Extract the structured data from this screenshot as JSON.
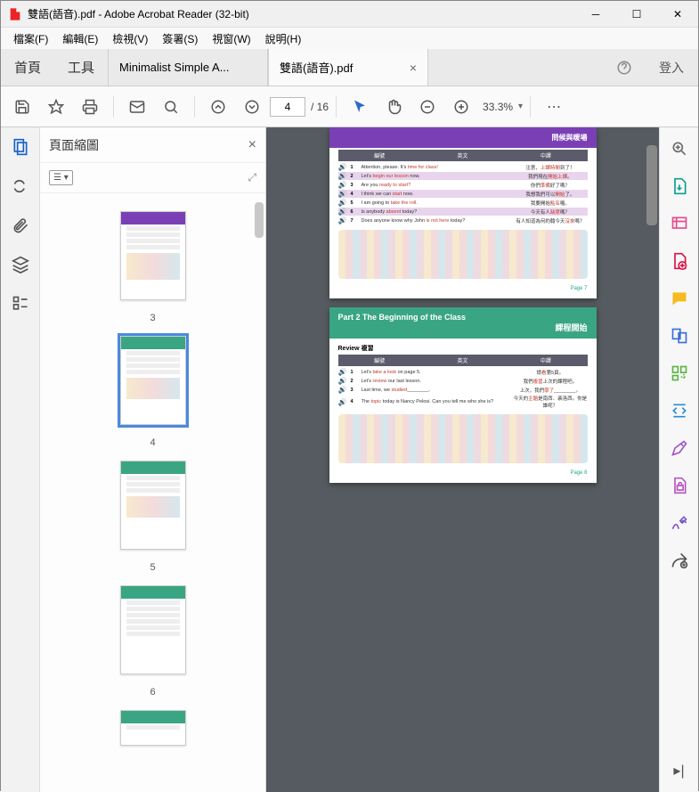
{
  "window": {
    "title": "雙語(語音).pdf - Adobe Acrobat Reader (32-bit)"
  },
  "menu": {
    "file": "檔案(F)",
    "edit": "編輯(E)",
    "view": "檢視(V)",
    "sign": "簽署(S)",
    "window": "視窗(W)",
    "help": "說明(H)"
  },
  "tabs": {
    "home": "首頁",
    "tools": "工具",
    "tab1": "Minimalist Simple A...",
    "tab2": "雙語(語音).pdf",
    "signin": "登入"
  },
  "toolbar": {
    "page_current": "4",
    "page_total": "/ 16",
    "zoom": "33.3%"
  },
  "thumbnails": {
    "title": "頁面縮圖",
    "labels": [
      "3",
      "4",
      "5",
      "6"
    ]
  },
  "doc": {
    "page4": {
      "banner": "問候與暖場",
      "head": {
        "c1": "編號",
        "c2": "英文",
        "c3": "中譯"
      },
      "rows": [
        {
          "n": "1",
          "en_a": "Attention, please. It's ",
          "en_b": "time for class!",
          "zh_a": "注意，",
          "zh_b": "上課時間",
          "zh_c": "到了！"
        },
        {
          "n": "2",
          "en_a": "Let's ",
          "en_b": "begin our lesson",
          "en_c": " now.",
          "zh_a": "我們現在",
          "zh_b": "開始上課",
          "zh_c": "。"
        },
        {
          "n": "3",
          "en_a": "Are you ",
          "en_b": "ready to start?",
          "zh_a": "你們",
          "zh_b": "準備",
          "zh_c": "好了嗎？"
        },
        {
          "n": "4",
          "en_a": "I think we can ",
          "en_b": "start",
          "en_c": " now.",
          "zh_a": "我想我們可以",
          "zh_b": "開始",
          "zh_c": "了。"
        },
        {
          "n": "5",
          "en_a": "I am going to ",
          "en_b": "take the roll.",
          "zh_a": "我要開始",
          "zh_b": "點名",
          "zh_c": "囉。"
        },
        {
          "n": "6",
          "en_a": "Is anybody ",
          "en_b": "absent",
          "en_c": " today?",
          "zh_a": "今天有人",
          "zh_b": "缺席",
          "zh_c": "嗎？"
        },
        {
          "n": "7",
          "en_a": "Does anyone know why John ",
          "en_b": "is not here",
          "en_c": " today?",
          "zh_a": "有人知道為何約翰今天",
          "zh_b": "沒來",
          "zh_c": "嗎？"
        }
      ],
      "footer": "Page 7"
    },
    "page5": {
      "banner_a": "Part 2  The Beginning of the Class",
      "banner_b": "課程開始",
      "subtitle": "Review 複習",
      "head": {
        "c1": "編號",
        "c2": "英文",
        "c3": "中譯"
      },
      "rows": [
        {
          "n": "1",
          "en_a": "Let's ",
          "en_b": "take a look",
          "en_c": " on page 5.",
          "zh_a": "請",
          "zh_b": "看",
          "zh_c": "第5頁。"
        },
        {
          "n": "2",
          "en_a": "Let's ",
          "en_b": "review",
          "en_c": " our last lesson.",
          "zh_a": "我們",
          "zh_b": "複習",
          "zh_c": "上次的課程吧。"
        },
        {
          "n": "3",
          "en_a": "Last time, we ",
          "en_b": "studied",
          "en_c": "________.",
          "zh_a": "上次，我們",
          "zh_b": "學了",
          "zh_c": "________。"
        },
        {
          "n": "4",
          "en_a": "The ",
          "en_b": "topic",
          "en_c": " today is Nancy Pelosi. Can you tell me who she is?",
          "zh_a": "今天的",
          "zh_b": "主題",
          "zh_c": "是南西．裴洛西。你是誰呢？"
        }
      ],
      "footer": "Page 8"
    }
  }
}
